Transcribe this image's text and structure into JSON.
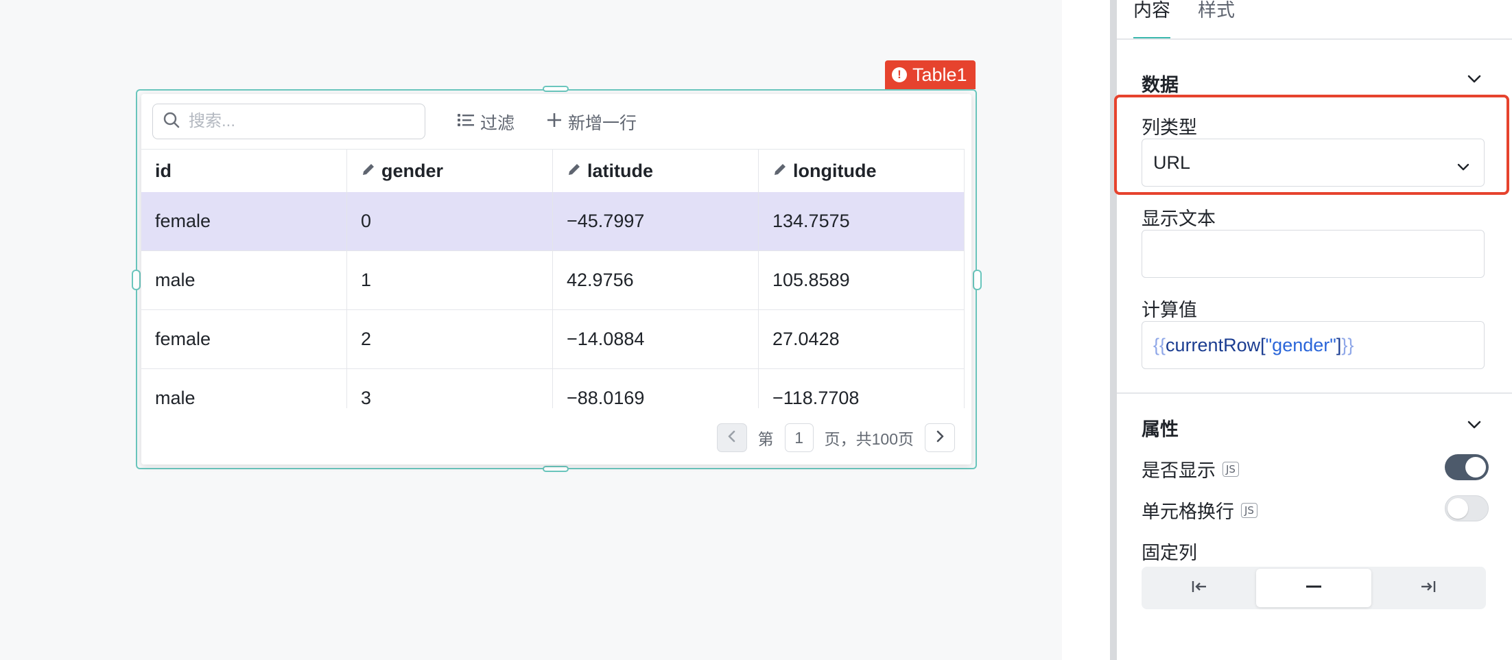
{
  "table": {
    "component_name": "Table1",
    "search_placeholder": "搜索...",
    "filter_label": "过滤",
    "add_row_label": "新增一行",
    "columns": [
      "id",
      "gender",
      "latitude",
      "longitude"
    ],
    "rows": [
      [
        "female",
        "0",
        "−45.7997",
        "134.7575"
      ],
      [
        "male",
        "1",
        "42.9756",
        "105.8589"
      ],
      [
        "female",
        "2",
        "−14.0884",
        "27.0428"
      ],
      [
        "male",
        "3",
        "−88.0169",
        "−118.7708"
      ]
    ],
    "pagination": {
      "page_prefix": "第",
      "current_page": "1",
      "page_suffix": "页，共100页"
    }
  },
  "panel": {
    "tabs": [
      "内容",
      "样式"
    ],
    "data_section": {
      "title": "数据",
      "column_type_label": "列类型",
      "column_type_value": "URL",
      "display_text_label": "显示文本",
      "display_text_value": "",
      "computed_label": "计算值",
      "computed_value": {
        "open": "{{",
        "code1": "currentRow[",
        "string": "\"gender\"",
        "code2": "]",
        "close": "}}"
      }
    },
    "props_section": {
      "title": "属性",
      "visible_label": "是否显示",
      "visible_on": true,
      "wrap_label": "单元格换行",
      "wrap_on": false,
      "js_badge": "JS",
      "fixed_label": "固定列"
    }
  },
  "colors": {
    "accent": "#3bb8ad",
    "highlight": "#e6432e",
    "selected_row": "#e2e0f7"
  }
}
